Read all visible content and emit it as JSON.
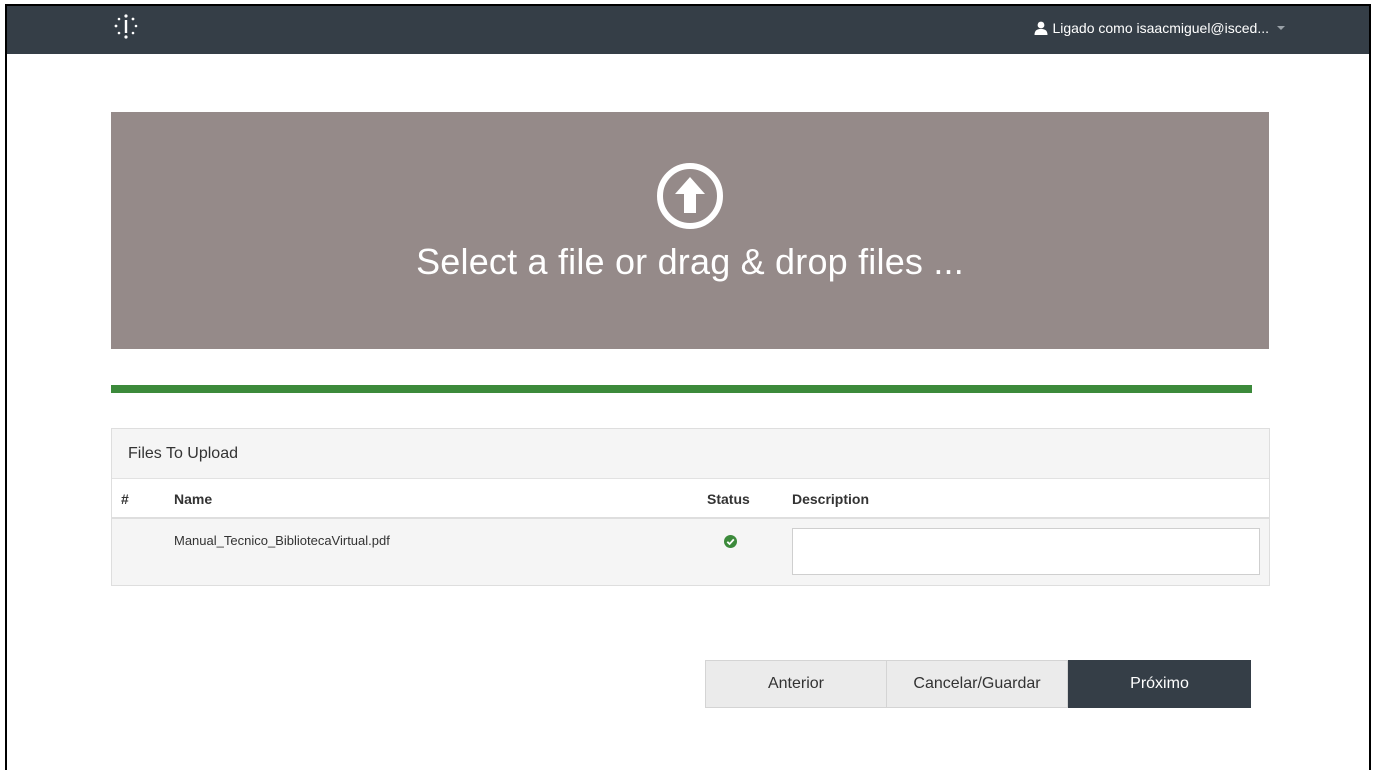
{
  "header": {
    "logo_icon": "dotted-circle-logo-icon",
    "user_label": "Ligado como isaacmiguel@isced...",
    "user_icon": "user-icon",
    "caret_icon": "caret-down-icon"
  },
  "dropzone": {
    "icon": "upload-arrow-icon",
    "text": "Select a file or drag & drop files ..."
  },
  "progress": {
    "value_percent": 100,
    "color": "#3c8a3b"
  },
  "files_panel": {
    "title": "Files To Upload",
    "columns": {
      "number": "#",
      "name": "Name",
      "status": "Status",
      "description": "Description"
    },
    "rows": [
      {
        "number": "",
        "name": "Manual_Tecnico_BibliotecaVirtual.pdf",
        "status_icon": "check-circle-icon",
        "status_color": "#3c8a3b",
        "description_value": ""
      }
    ]
  },
  "buttons": {
    "previous": "Anterior",
    "cancel_save": "Cancelar/Guardar",
    "next": "Próximo"
  },
  "colors": {
    "topbar": "#353e47",
    "dropzone": "#958a89",
    "accent_green": "#3c8a3b"
  }
}
